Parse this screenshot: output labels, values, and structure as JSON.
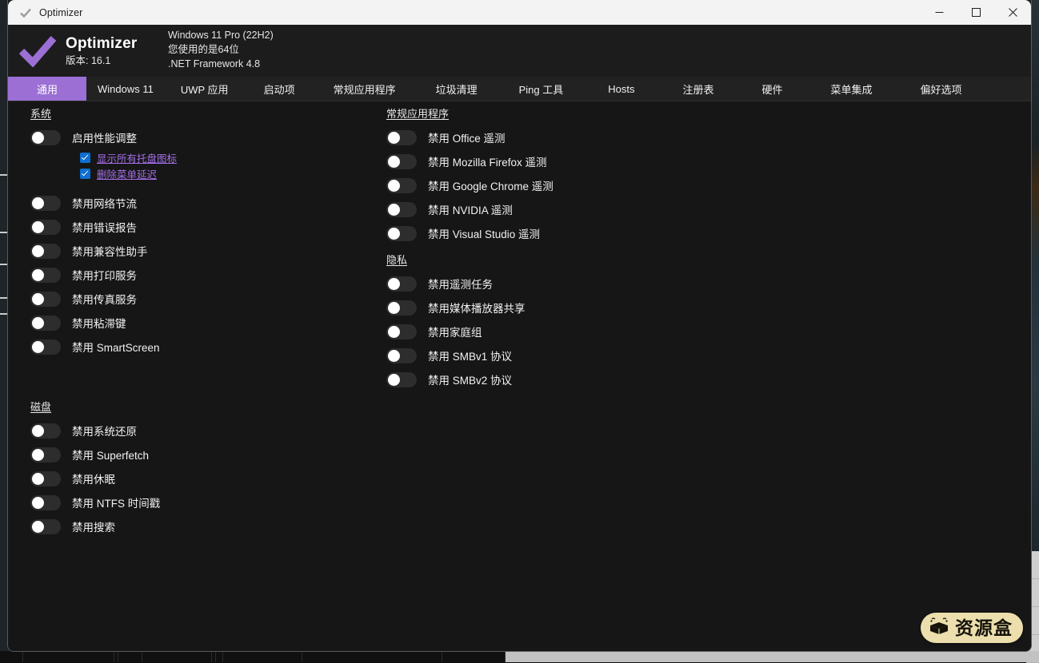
{
  "titlebar": {
    "title": "Optimizer",
    "icon": "checkmark-icon",
    "minimize_label": "—",
    "maximize_label": "□",
    "close_label": "✕"
  },
  "header": {
    "app_name": "Optimizer",
    "version_label": "版本: 16.1",
    "os_line": "Windows 11 Pro (22H2)",
    "arch_line": "您使用的是64位",
    "framework_line": ".NET Framework 4.8",
    "logo_color": "#9b6fd4"
  },
  "tabs": {
    "active_color": "#9b6fd4",
    "items": [
      {
        "label": "通用",
        "active": true
      },
      {
        "label": "Windows 11",
        "active": false
      },
      {
        "label": "UWP 应用",
        "active": false
      },
      {
        "label": "启动项",
        "active": false
      },
      {
        "label": "常规应用程序",
        "active": false
      },
      {
        "label": "垃圾清理",
        "active": false
      },
      {
        "label": "Ping 工具",
        "active": false
      },
      {
        "label": "Hosts",
        "active": false
      },
      {
        "label": "注册表",
        "active": false
      },
      {
        "label": "硬件",
        "active": false
      },
      {
        "label": "菜单集成",
        "active": false
      },
      {
        "label": "偏好选项",
        "active": false
      }
    ]
  },
  "left_column": {
    "sections": [
      {
        "title": "系统",
        "toggles": [
          {
            "label": "启用性能调整",
            "on": false
          },
          {
            "label": "禁用网络节流",
            "on": false
          },
          {
            "label": "禁用错误报告",
            "on": false
          },
          {
            "label": "禁用兼容性助手",
            "on": false
          },
          {
            "label": "禁用打印服务",
            "on": false
          },
          {
            "label": "禁用传真服务",
            "on": false
          },
          {
            "label": "禁用粘滞键",
            "on": false
          },
          {
            "label": "禁用 SmartScreen",
            "on": false
          }
        ],
        "sub_checkboxes": [
          {
            "label": "显示所有托盘图标",
            "checked": true
          },
          {
            "label": "删除菜单延迟",
            "checked": true
          }
        ]
      },
      {
        "title": "磁盘",
        "toggles": [
          {
            "label": "禁用系统还原",
            "on": false
          },
          {
            "label": "禁用 Superfetch",
            "on": false
          },
          {
            "label": "禁用休眠",
            "on": false
          },
          {
            "label": "禁用 NTFS 时间戳",
            "on": false
          },
          {
            "label": "禁用搜索",
            "on": false
          }
        ],
        "sub_checkboxes": []
      }
    ]
  },
  "right_column": {
    "sections": [
      {
        "title": "常规应用程序",
        "toggles": [
          {
            "label": "禁用 Office 遥测",
            "on": false
          },
          {
            "label": "禁用 Mozilla Firefox 遥测",
            "on": false
          },
          {
            "label": "禁用 Google Chrome 遥测",
            "on": false
          },
          {
            "label": "禁用 NVIDIA 遥测",
            "on": false
          },
          {
            "label": "禁用 Visual Studio 遥测",
            "on": false
          }
        ],
        "sub_checkboxes": []
      },
      {
        "title": "隐私",
        "toggles": [
          {
            "label": "禁用遥测任务",
            "on": false
          },
          {
            "label": "禁用媒体播放器共享",
            "on": false
          },
          {
            "label": "禁用家庭组",
            "on": false
          },
          {
            "label": "禁用 SMBv1 协议",
            "on": false
          },
          {
            "label": "禁用 SMBv2 协议",
            "on": false
          }
        ],
        "sub_checkboxes": []
      }
    ]
  },
  "watermark": {
    "text": "资源盒",
    "icon": "box-icon",
    "background": "#ecdfad"
  }
}
